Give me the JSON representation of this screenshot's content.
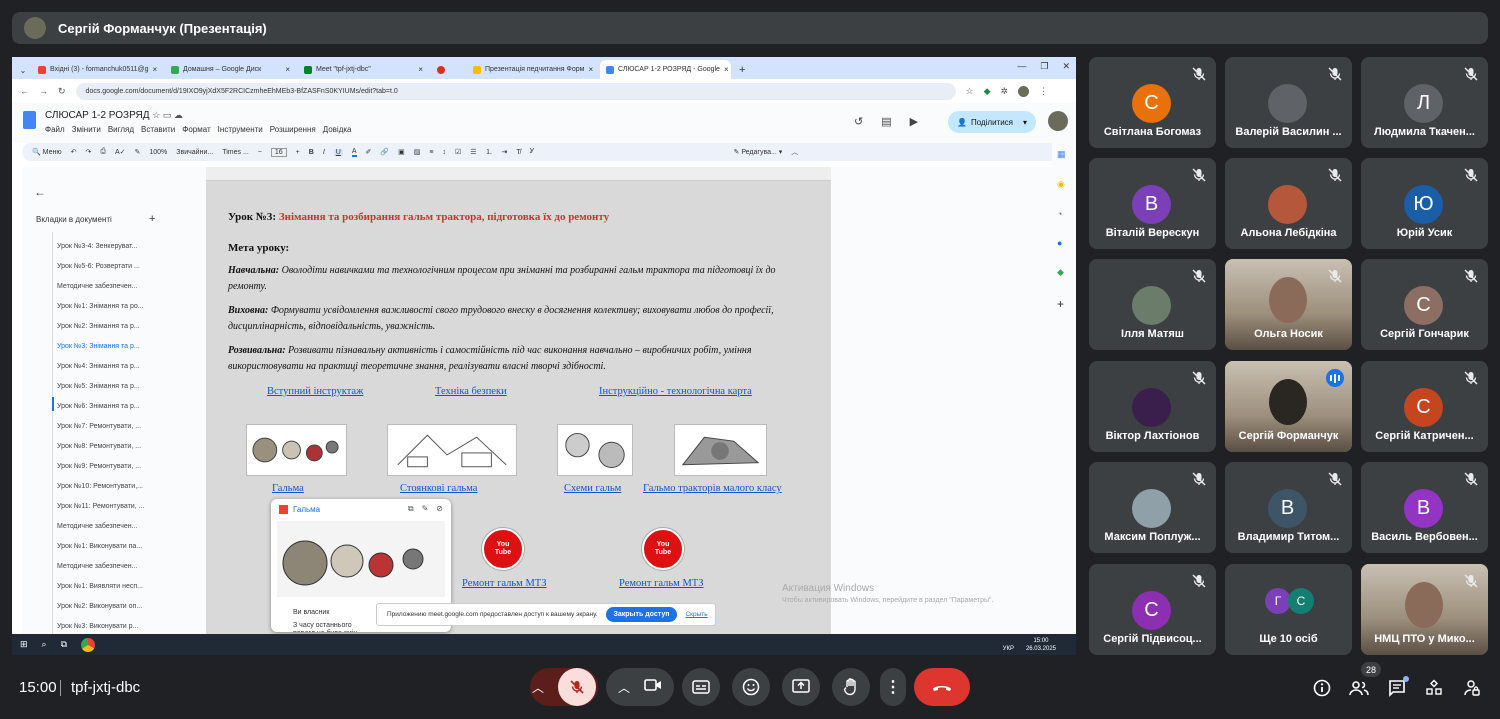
{
  "presenter": {
    "label": "Сергій Форманчук (Презентація)"
  },
  "browser": {
    "tabs": [
      {
        "label": "Вхідні (3) - formanchuk0511@g",
        "color": "#ea4335"
      },
      {
        "label": "Домашня – Google Диск",
        "color": "#34a853"
      },
      {
        "label": "Meet \"tpf-jxtj-dbc\"",
        "color": "#00832d"
      },
      {
        "label": "",
        "color": "#d93025"
      },
      {
        "label": "Презентація педчитання Форм",
        "color": "#fbbc04"
      },
      {
        "label": "СЛЮСАР 1-2 РОЗРЯД - Google",
        "color": "#4285f4"
      }
    ],
    "url": "docs.google.com/document/d/19IXO9yjXdX5F2RCICzmheEhMEb3-BfZASFnS0KYIUMs/edit?tab=t.0"
  },
  "doc": {
    "title": "СЛЮСАР 1-2 РОЗРЯД",
    "menus": [
      "Файл",
      "Змінити",
      "Вигляд",
      "Вставити",
      "Формат",
      "Інструменти",
      "Розширення",
      "Довідка"
    ],
    "share_label": "Поділитися",
    "toolbar": {
      "menu": "Меню",
      "zoom": "100%",
      "style": "Звичайни...",
      "font": "Times ...",
      "size": "16",
      "edit_mode": "Редагува..."
    },
    "outline": {
      "header": "Вкладки в документі",
      "items": [
        "Урок №3-4: Зенкеруват...",
        "Урок №5-6: Розвертати ...",
        "Методичне забезпечен...",
        "Урок №1: Знімання та ро...",
        "Урок №2: Знімання та р...",
        "Урок №3: Знімання та р...",
        "Урок №4: Знімання та р...",
        "Урок №5: Знімання та р...",
        "Урок №6: Знімання та р...",
        "Урок №7: Ремонтувати, ...",
        "Урок №8: Ремонтувати, ...",
        "Урок №9: Ремонтувати, ...",
        "Урок №10: Ремонтувати,...",
        "Урок №11: Ремонтувати, ...",
        "Методичне забезпечен...",
        "Урок №1: Виконувати па...",
        "Методичне забезпечен...",
        "Урок №1: Виявляти несп...",
        "Урок №2: Виконувати оп...",
        "Урок №3: Виконувати р..."
      ]
    },
    "page": {
      "lesson_prefix": "Урок №3:",
      "lesson_title": "Знімання та розбирання гальм трактора, підготовка їх до ремонту",
      "goal": "Мета уроку:",
      "p1_label": "Навчальна:",
      "p1_text": "Оволодіти навичками та технологічним процесом при зніманні та розбиранні гальм трактора та підготовці їх до ремонту.",
      "p2_label": "Виховна:",
      "p2_text": "Формувати усвідомлення важливості свого трудового внеску в досягнення колективу; виховувати любов до професії, дисциплінарність, відповідальність, уважність.",
      "p3_label": "Розвивальна:",
      "p3_text": "Розвивати пізнавальну активність і самостійність під час виконання навчально – виробничих робіт, уміння використовувати на практиці теоретичне знання, реалізувати власні творчі здібності.",
      "links_top": [
        "Вступний інструктаж",
        "Техніка безпеки",
        "Інструкційно - технологічна карта"
      ],
      "links_images": [
        "Гальма",
        "Стоянкові гальма",
        "Схеми гальм",
        "Гальмо тракторів малого класу"
      ],
      "links_video": [
        "Ремонт гальм МТЗ",
        "Ремонт гальм МТЗ"
      ],
      "youtube_top": "You",
      "youtube_bottom": "Tube"
    },
    "popup": {
      "title": "Гальма",
      "owner": "Ви власник",
      "time": "З часу останнього перегл не було змін"
    },
    "notice": {
      "text": "Приложению meet.google.com предоставлен доступ к вашему экрану.",
      "stop": "Закрыть доступ",
      "hide": "Скрыть"
    },
    "activation": {
      "title": "Активация Windows",
      "subtitle": "Чтобы активировать Windows, перейдите в раздел \"Параметры\"."
    },
    "taskbar": {
      "lang": "УКР",
      "time": "15:00",
      "date": "26.03.2025"
    }
  },
  "participants": [
    {
      "name": "Світлана Богомаз",
      "initial": "С",
      "color": "#e8710a"
    },
    {
      "name": "Валерій Василин ...",
      "initial": "",
      "color": "#5f6368"
    },
    {
      "name": "Людмила Ткачен...",
      "initial": "Л",
      "color": "#5f6368"
    },
    {
      "name": "Віталій Верескун",
      "initial": "В",
      "color": "#7b3fb8"
    },
    {
      "name": "Альона Лебідкіна",
      "initial": "",
      "color": "#b5573a"
    },
    {
      "name": "Юрій Усик",
      "initial": "Ю",
      "color": "#1a5ea8"
    },
    {
      "name": "Ілля Матяш",
      "initial": "",
      "color": "#6b7d6a"
    },
    {
      "name": "Ольга Носик",
      "initial": "",
      "color": "#8d8070"
    },
    {
      "name": "Сергій Гончарик",
      "initial": "С",
      "color": "#8d6e63"
    },
    {
      "name": "Віктор Лахтіонов",
      "initial": "",
      "color": "#3a1f4d"
    },
    {
      "name": "Сергій Форманчук",
      "initial": "",
      "color": "#6d6d66"
    },
    {
      "name": "Сергій Катричен...",
      "initial": "С",
      "color": "#c5451f"
    },
    {
      "name": "Максим Поплуж...",
      "initial": "",
      "color": "#8fa0a8"
    },
    {
      "name": "Владимир Титом...",
      "initial": "В",
      "color": "#3d5566"
    },
    {
      "name": "Василь Вербовен...",
      "initial": "В",
      "color": "#9334c4"
    },
    {
      "name": "Сергій Підвисоц...",
      "initial": "С",
      "color": "#8c2fb1"
    },
    {
      "name": "Ще 10 осіб",
      "initial": "",
      "color": ""
    },
    {
      "name": "НМЦ ПТО у Мико...",
      "initial": "",
      "color": "#a0a8b0"
    }
  ],
  "others": {
    "a": "Г",
    "b": "С",
    "a_color": "#7b3fb8",
    "b_color": "#137e72"
  },
  "bottom": {
    "time": "15:00",
    "meeting_code": "tpf-jxtj-dbc",
    "participant_count": "28"
  }
}
